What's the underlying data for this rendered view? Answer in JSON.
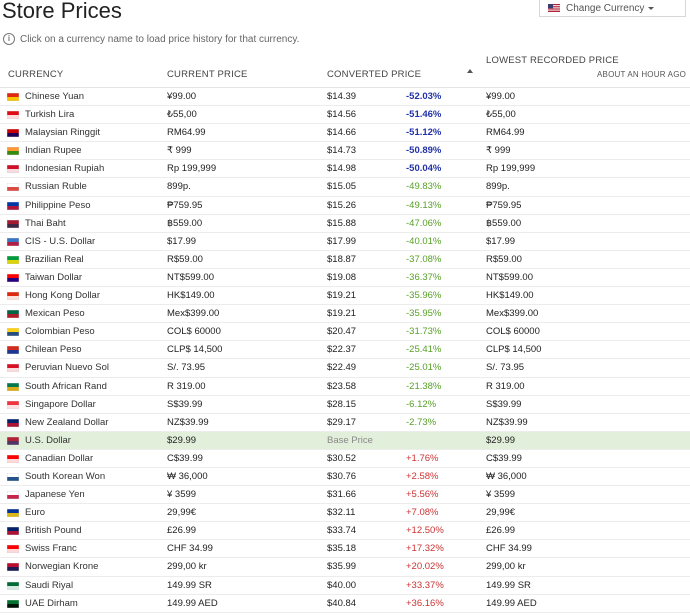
{
  "title": "Store Prices",
  "change_currency": "Change Currency",
  "info": "Click on a currency name to load price history for that currency.",
  "headers": {
    "currency": "CURRENCY",
    "current_price": "CURRENT PRICE",
    "converted_price": "CONVERTED PRICE",
    "lowest": "LOWEST RECORDED PRICE",
    "lowest_sub": "ABOUT AN HOUR AGO"
  },
  "rows": [
    {
      "name": "Chinese Yuan",
      "price": "¥99.00",
      "conv": "$14.39",
      "pct": "-52.03%",
      "low": "¥99.00",
      "cls": "neg",
      "flag": [
        "#de2910",
        "#ffde00"
      ]
    },
    {
      "name": "Turkish Lira",
      "price": "₺55,00",
      "conv": "$14.56",
      "pct": "-51.46%",
      "low": "₺55,00",
      "cls": "neg",
      "flag": [
        "#e30a17",
        "#ffffff"
      ]
    },
    {
      "name": "Malaysian Ringgit",
      "price": "RM64.99",
      "conv": "$14.66",
      "pct": "-51.12%",
      "low": "RM64.99",
      "cls": "neg",
      "flag": [
        "#cc0001",
        "#010066"
      ]
    },
    {
      "name": "Indian Rupee",
      "price": "₹ 999",
      "conv": "$14.73",
      "pct": "-50.89%",
      "low": "₹ 999",
      "cls": "neg",
      "flag": [
        "#ff9933",
        "#138808"
      ]
    },
    {
      "name": "Indonesian Rupiah",
      "price": "Rp 199,999",
      "conv": "$14.98",
      "pct": "-50.04%",
      "low": "Rp 199,999",
      "cls": "neg",
      "flag": [
        "#ce1126",
        "#ffffff"
      ]
    },
    {
      "name": "Russian Ruble",
      "price": "899p.",
      "conv": "$15.05",
      "pct": "-49.83%",
      "low": "899p.",
      "cls": "mid",
      "flag": [
        "#ffffff",
        "#d52b1e"
      ]
    },
    {
      "name": "Philippine Peso",
      "price": "₱759.95",
      "conv": "$15.26",
      "pct": "-49.13%",
      "low": "₱759.95",
      "cls": "mid",
      "flag": [
        "#0038a8",
        "#ce1126"
      ]
    },
    {
      "name": "Thai Baht",
      "price": "฿559.00",
      "conv": "$15.88",
      "pct": "-47.06%",
      "low": "฿559.00",
      "cls": "mid",
      "flag": [
        "#a51931",
        "#2d2a4a"
      ]
    },
    {
      "name": "CIS - U.S. Dollar",
      "price": "$17.99",
      "conv": "$17.99",
      "pct": "-40.01%",
      "low": "$17.99",
      "cls": "mid",
      "flag": [
        "#3a75c4",
        "#c8102e"
      ]
    },
    {
      "name": "Brazilian Real",
      "price": "R$59.00",
      "conv": "$18.87",
      "pct": "-37.08%",
      "low": "R$59.00",
      "cls": "mid",
      "flag": [
        "#009c3b",
        "#ffdf00"
      ]
    },
    {
      "name": "Taiwan Dollar",
      "price": "NT$599.00",
      "conv": "$19.08",
      "pct": "-36.37%",
      "low": "NT$599.00",
      "cls": "mid",
      "flag": [
        "#fe0000",
        "#000095"
      ]
    },
    {
      "name": "Hong Kong Dollar",
      "price": "HK$149.00",
      "conv": "$19.21",
      "pct": "-35.96%",
      "low": "HK$149.00",
      "cls": "mid",
      "flag": [
        "#de2910",
        "#ffffff"
      ]
    },
    {
      "name": "Mexican Peso",
      "price": "Mex$399.00",
      "conv": "$19.21",
      "pct": "-35.95%",
      "low": "Mex$399.00",
      "cls": "mid",
      "flag": [
        "#006847",
        "#ce1126"
      ]
    },
    {
      "name": "Colombian Peso",
      "price": "COL$ 60000",
      "conv": "$20.47",
      "pct": "-31.73%",
      "low": "COL$ 60000",
      "cls": "mid",
      "flag": [
        "#fcd116",
        "#003893"
      ]
    },
    {
      "name": "Chilean Peso",
      "price": "CLP$ 14,500",
      "conv": "$22.37",
      "pct": "-25.41%",
      "low": "CLP$ 14,500",
      "cls": "mid",
      "flag": [
        "#d52b1e",
        "#0039a6"
      ]
    },
    {
      "name": "Peruvian Nuevo Sol",
      "price": "S/. 73.95",
      "conv": "$22.49",
      "pct": "-25.01%",
      "low": "S/. 73.95",
      "cls": "mid",
      "flag": [
        "#d91023",
        "#ffffff"
      ]
    },
    {
      "name": "South African Rand",
      "price": "R 319.00",
      "conv": "$23.58",
      "pct": "-21.38%",
      "low": "R 319.00",
      "cls": "mid",
      "flag": [
        "#007a4d",
        "#ffb612"
      ]
    },
    {
      "name": "Singapore Dollar",
      "price": "S$39.99",
      "conv": "$28.15",
      "pct": "-6.12%",
      "low": "S$39.99",
      "cls": "mid",
      "flag": [
        "#ef3340",
        "#ffffff"
      ]
    },
    {
      "name": "New Zealand Dollar",
      "price": "NZ$39.99",
      "conv": "$29.17",
      "pct": "-2.73%",
      "low": "NZ$39.99",
      "cls": "mid",
      "flag": [
        "#012169",
        "#c8102e"
      ]
    },
    {
      "name": "U.S. Dollar",
      "price": "$29.99",
      "conv": "Base Price",
      "pct": "",
      "low": "$29.99",
      "cls": "base",
      "flag": [
        "#b22234",
        "#3c3b6e"
      ]
    },
    {
      "name": "Canadian Dollar",
      "price": "C$39.99",
      "conv": "$30.52",
      "pct": "+1.76%",
      "low": "C$39.99",
      "cls": "pos",
      "flag": [
        "#ff0000",
        "#ffffff"
      ]
    },
    {
      "name": "South Korean Won",
      "price": "₩ 36,000",
      "conv": "$30.76",
      "pct": "+2.58%",
      "low": "₩ 36,000",
      "cls": "pos",
      "flag": [
        "#ffffff",
        "#003478"
      ]
    },
    {
      "name": "Japanese Yen",
      "price": "¥ 3599",
      "conv": "$31.66",
      "pct": "+5.56%",
      "low": "¥ 3599",
      "cls": "pos",
      "flag": [
        "#ffffff",
        "#bc002d"
      ]
    },
    {
      "name": "Euro",
      "price": "29,99€",
      "conv": "$32.11",
      "pct": "+7.08%",
      "low": "29,99€",
      "cls": "pos",
      "flag": [
        "#003399",
        "#ffcc00"
      ]
    },
    {
      "name": "British Pound",
      "price": "£26.99",
      "conv": "$33.74",
      "pct": "+12.50%",
      "low": "£26.99",
      "cls": "pos",
      "flag": [
        "#012169",
        "#c8102e"
      ]
    },
    {
      "name": "Swiss Franc",
      "price": "CHF 34.99",
      "conv": "$35.18",
      "pct": "+17.32%",
      "low": "CHF 34.99",
      "cls": "pos",
      "flag": [
        "#ff0000",
        "#ffffff"
      ]
    },
    {
      "name": "Norwegian Krone",
      "price": "299,00 kr",
      "conv": "$35.99",
      "pct": "+20.02%",
      "low": "299,00 kr",
      "cls": "pos",
      "flag": [
        "#ba0c2f",
        "#00205b"
      ]
    },
    {
      "name": "Saudi Riyal",
      "price": "149.99 SR",
      "conv": "$40.00",
      "pct": "+33.37%",
      "low": "149.99 SR",
      "cls": "pos",
      "flag": [
        "#006c35",
        "#ffffff"
      ]
    },
    {
      "name": "UAE Dirham",
      "price": "149.99 AED",
      "conv": "$40.84",
      "pct": "+36.16%",
      "low": "149.99 AED",
      "cls": "pos",
      "flag": [
        "#00732f",
        "#000000"
      ]
    }
  ]
}
